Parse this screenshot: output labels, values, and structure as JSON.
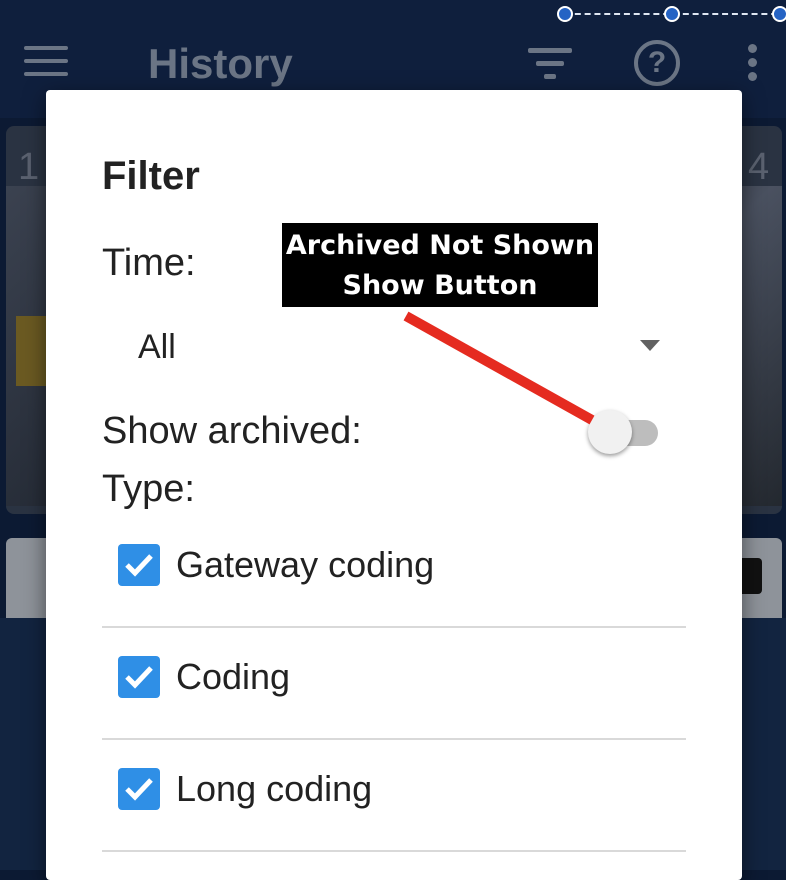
{
  "app": {
    "title": "History",
    "left_number": "1",
    "right_number": "4",
    "icons": [
      "menu-icon",
      "filter-icon",
      "help-icon",
      "more-icon"
    ]
  },
  "dialog": {
    "title": "Filter",
    "time_label": "Time:",
    "time_value": "All",
    "show_archived_label": "Show archived:",
    "show_archived_on": false,
    "type_label": "Type:",
    "types": [
      {
        "label": "Gateway coding",
        "checked": true
      },
      {
        "label": "Coding",
        "checked": true
      },
      {
        "label": "Long coding",
        "checked": true
      }
    ]
  },
  "annotation": {
    "line1": "Archived Not Shown",
    "line2": "Show Button"
  },
  "colors": {
    "checkbox": "#2f8fe6",
    "annotation_arrow": "#e52b20",
    "appbar": "#0f1f3d"
  }
}
